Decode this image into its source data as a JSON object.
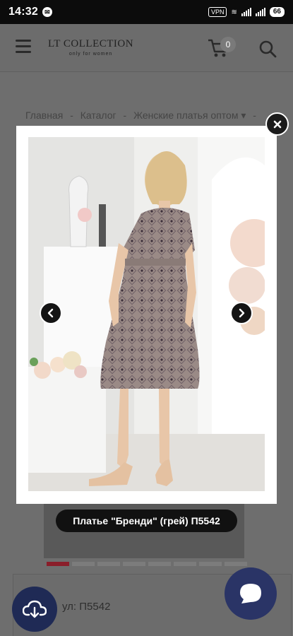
{
  "status_bar": {
    "time": "14:32",
    "vpn": "VPN",
    "battery": "66"
  },
  "header": {
    "logo_title": "LT COLLECTION",
    "logo_tagline": "only for women",
    "cart_count": "0"
  },
  "breadcrumb": [
    "Главная",
    "-",
    "Каталог",
    "-",
    "Женские платья оптом ▾",
    "-"
  ],
  "lightbox": {
    "caption": "Платье \"Бренди\" (грей) П5542"
  },
  "product": {
    "article": "ул: П5542",
    "gallery_dots": 8,
    "active_dot": 0
  },
  "colors": {
    "brand_dark": "#1f2a55",
    "accent_red": "#8a1e2a"
  },
  "icons": [
    "menu-icon",
    "cart-icon",
    "search-icon",
    "close-icon",
    "chevron-left-icon",
    "chevron-right-icon",
    "cloud-download-icon",
    "chat-icon"
  ]
}
